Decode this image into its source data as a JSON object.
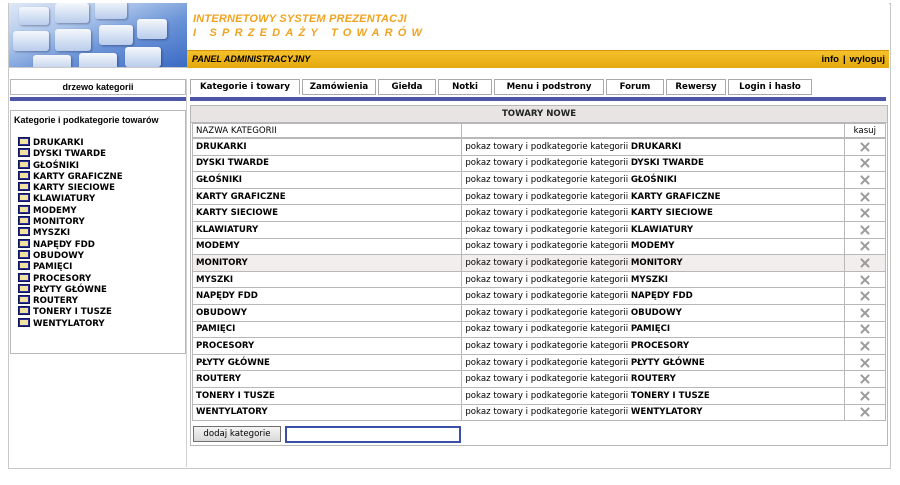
{
  "header": {
    "title_line1": "INTERNETOWY SYSTEM PREZENTACJI",
    "title_line2": "I SPRZEDAŻY TOWARÓW",
    "panel_title": "PANEL ADMINISTRACYJNY",
    "link_info": "info",
    "link_separator": "|",
    "link_logout": "wyloguj"
  },
  "sidebar": {
    "heading_button": "drzewo kategorii",
    "box_title": "Kategorie i podkategorie towarów",
    "items": [
      {
        "label": "DRUKARKI"
      },
      {
        "label": "DYSKI TWARDE"
      },
      {
        "label": "GŁOŚNIKI"
      },
      {
        "label": "KARTY GRAFICZNE"
      },
      {
        "label": "KARTY SIECIOWE"
      },
      {
        "label": "KLAWIATURY"
      },
      {
        "label": "MODEMY"
      },
      {
        "label": "MONITORY"
      },
      {
        "label": "MYSZKI"
      },
      {
        "label": "NAPĘDY FDD"
      },
      {
        "label": "OBUDOWY"
      },
      {
        "label": "PAMIĘCI"
      },
      {
        "label": "PROCESORY"
      },
      {
        "label": "PŁYTY GŁÓWNE"
      },
      {
        "label": "ROUTERY"
      },
      {
        "label": "TONERY I TUSZE"
      },
      {
        "label": "WENTYLATORY"
      }
    ]
  },
  "tabs": [
    {
      "label": "Kategorie i towary"
    },
    {
      "label": "Zamówienia"
    },
    {
      "label": "Giełda"
    },
    {
      "label": "Notki"
    },
    {
      "label": "Menu i podstrony"
    },
    {
      "label": "Forum"
    },
    {
      "label": "Rewersy"
    },
    {
      "label": "Login i hasło"
    }
  ],
  "main": {
    "table_title": "TOWARY NOWE",
    "col_name": "NAZWA KATEGORII",
    "col_action": "",
    "col_delete": "kasuj",
    "link_prefix": "pokaz towary i podkategorie kategorii",
    "rows": [
      {
        "name": "DRUKARKI",
        "link_name": "DRUKARKI"
      },
      {
        "name": "DYSKI TWARDE",
        "link_name": "DYSKI TWARDE"
      },
      {
        "name": "GŁOŚNIKI",
        "link_name": "GŁOŚNIKI"
      },
      {
        "name": "KARTY GRAFICZNE",
        "link_name": "KARTY GRAFICZNE"
      },
      {
        "name": "KARTY SIECIOWE",
        "link_name": "KARTY SIECIOWE"
      },
      {
        "name": "KLAWIATURY",
        "link_name": "KLAWIATURY"
      },
      {
        "name": "MODEMY",
        "link_name": "MODEMY"
      },
      {
        "name": "MONITORY",
        "link_name": "MONITORY"
      },
      {
        "name": "MYSZKI",
        "link_name": "MYSZKI"
      },
      {
        "name": "NAPĘDY FDD",
        "link_name": "NAPĘDY FDD"
      },
      {
        "name": "OBUDOWY",
        "link_name": "OBUDOWY"
      },
      {
        "name": "PAMIĘCI",
        "link_name": "PAMIĘCI"
      },
      {
        "name": "PROCESORY",
        "link_name": "PROCESORY"
      },
      {
        "name": "PŁYTY GŁÓWNE",
        "link_name": "PŁYTY GŁÓWNE"
      },
      {
        "name": "ROUTERY",
        "link_name": "ROUTERY"
      },
      {
        "name": "TONERY I TUSZE",
        "link_name": "TONERY I TUSZE"
      },
      {
        "name": "WENTYLATORY",
        "link_name": "WENTYLATORY"
      }
    ],
    "add_button": "dodaj kategorie",
    "add_input_value": ""
  },
  "colors": {
    "accent_orange": "#f0a321",
    "header_bar": "#e4a80e",
    "nav_bar": "#4d55a6",
    "folder_blue": "#2a2f98"
  },
  "icons": {
    "delete": "x-icon",
    "category": "folder-icon"
  }
}
